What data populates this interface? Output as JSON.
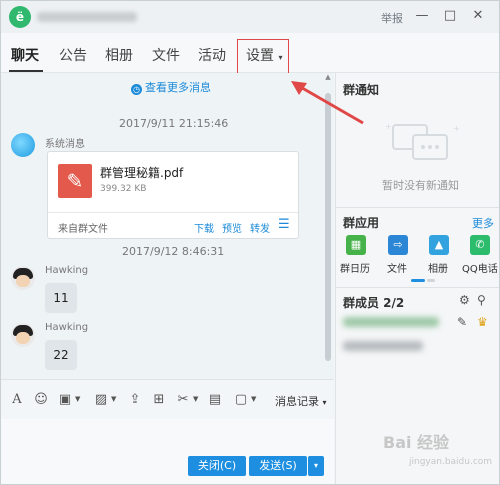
{
  "app": {
    "logo_char": "ë"
  },
  "titlebar": {
    "report": "举报",
    "minimize": "—",
    "maximize": "□",
    "close": "✕"
  },
  "tabs": [
    {
      "label": "聊天",
      "active": true
    },
    {
      "label": "公告"
    },
    {
      "label": "相册"
    },
    {
      "label": "文件"
    },
    {
      "label": "活动"
    },
    {
      "label": "设置",
      "dropdown": "▾"
    }
  ],
  "chat": {
    "more_messages": "查看更多消息",
    "timestamp_1": "2017/9/11 21:15:46",
    "system_sender": "系统消息",
    "file": {
      "name": "群管理秘籍.pdf",
      "size": "399.32 KB",
      "source": "来自群文件",
      "actions": [
        "下载",
        "预览",
        "转发"
      ],
      "menu_icon": "☰"
    },
    "timestamp_2": "2017/9/12 8:46:31",
    "messages": [
      {
        "sender": "Hawking",
        "text": "11"
      },
      {
        "sender": "Hawking",
        "text": "22"
      }
    ]
  },
  "toolbar": {
    "history": "消息记录",
    "history_arrow": "▾"
  },
  "buttons": {
    "close": "关闭(C)",
    "send": "发送(S)",
    "send_dropdown": "▾"
  },
  "right_panel": {
    "notice_title": "群通知",
    "notice_empty": "暂时没有新通知",
    "apps_title": "群应用",
    "apps_more": "更多",
    "apps": [
      {
        "label": "群日历",
        "icon": "calendar-icon",
        "color": "#46b24a"
      },
      {
        "label": "文件",
        "icon": "folder-icon",
        "color": "#2c86d6"
      },
      {
        "label": "相册",
        "icon": "photo-icon",
        "color": "#33a3df"
      },
      {
        "label": "QQ电话",
        "icon": "phone-icon",
        "color": "#2dbb6c"
      }
    ],
    "members_title": "群成员 2/2"
  },
  "watermark": {
    "text": "Bai 经验",
    "sub": "jingyan.baidu.com"
  },
  "colors": {
    "accent": "#1e8fe0",
    "highlight_box": "#e04848"
  }
}
